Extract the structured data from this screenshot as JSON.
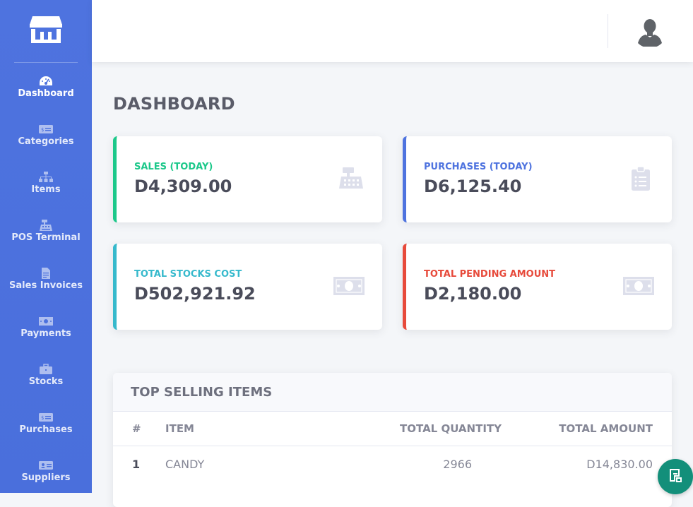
{
  "colors": {
    "sidebar": "#4e73df",
    "success": "#1cc88a",
    "primary": "#4e73df",
    "info": "#36b9cc",
    "danger": "#e74a3b",
    "fab": "#138f7a"
  },
  "sidebar": {
    "logo_icon": "store-icon",
    "items": [
      {
        "label": "Dashboard",
        "icon": "tachometer-icon",
        "active": true
      },
      {
        "label": "Categories",
        "icon": "money-icon",
        "active": false
      },
      {
        "label": "Items",
        "icon": "sitemap-icon",
        "active": false
      },
      {
        "label": "POS Terminal",
        "icon": "cash-register-icon",
        "active": false
      },
      {
        "label": "Sales Invoices",
        "icon": "invoice-icon",
        "active": false
      },
      {
        "label": "Payments",
        "icon": "money-bill-icon",
        "active": false
      },
      {
        "label": "Stocks",
        "icon": "briefcase-icon",
        "active": false
      },
      {
        "label": "Purchases",
        "icon": "money-icon",
        "active": false
      },
      {
        "label": "Suppliers",
        "icon": "id-card-icon",
        "active": false
      }
    ]
  },
  "topbar": {
    "avatar_icon": "user-avatar-icon"
  },
  "page": {
    "title": "DASHBOARD"
  },
  "cards": [
    {
      "label": "SALES (TODAY)",
      "value": "D4,309.00",
      "icon": "cash-register-icon",
      "color": "#1cc88a"
    },
    {
      "label": "PURCHASES (TODAY)",
      "value": "D6,125.40",
      "icon": "clipboard-list-icon",
      "color": "#4e73df"
    },
    {
      "label": "TOTAL STOCKS COST",
      "value": "D502,921.92",
      "icon": "money-bill-icon",
      "color": "#36b9cc"
    },
    {
      "label": "TOTAL PENDING AMOUNT",
      "value": "D2,180.00",
      "icon": "money-bill-icon",
      "color": "#e74a3b"
    }
  ],
  "top_selling": {
    "title": "TOP SELLING ITEMS",
    "columns": [
      "#",
      "ITEM",
      "TOTAL QUANTITY",
      "TOTAL AMOUNT"
    ],
    "rows": [
      {
        "rank": "1",
        "item": "CANDY",
        "quantity": "2966",
        "amount": "D14,830.00"
      }
    ]
  },
  "fab": {
    "icon": "chat-widget-icon"
  }
}
